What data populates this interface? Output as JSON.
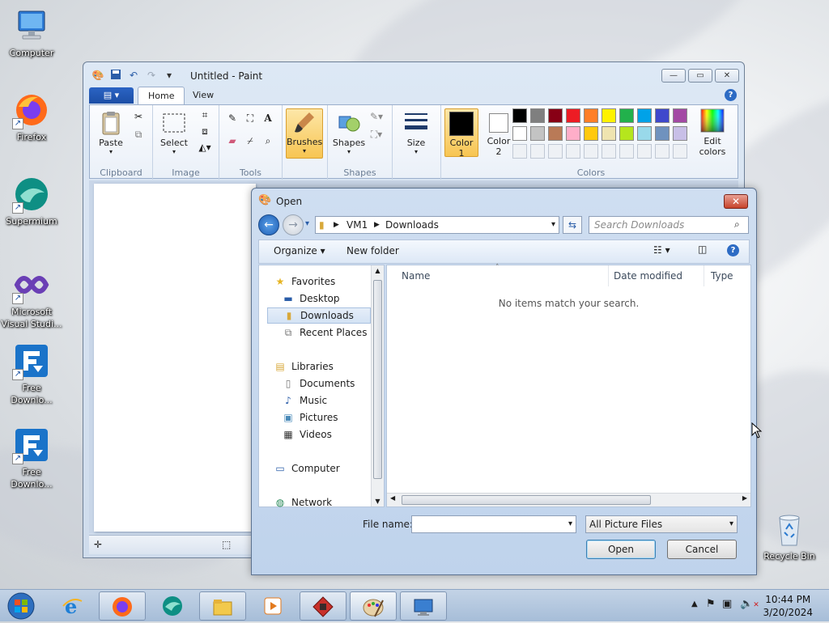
{
  "desktop": {
    "icons": [
      {
        "label": "Computer"
      },
      {
        "label": "Firefox"
      },
      {
        "label": "Supermium"
      },
      {
        "label_line1": "Microsoft",
        "label_line2": "Visual Studi..."
      },
      {
        "label_line1": "Free",
        "label_line2": "Downlo..."
      },
      {
        "label_line1": "Free",
        "label_line2": "Downlo..."
      },
      {
        "label": "Recycle Bin"
      }
    ]
  },
  "paint": {
    "title": "Untitled - Paint",
    "tabs": [
      "Home",
      "View"
    ],
    "groups": {
      "clipboard": {
        "name": "Clipboard",
        "paste": "Paste"
      },
      "image": {
        "name": "Image",
        "select": "Select"
      },
      "tools": {
        "name": "Tools"
      },
      "brushes": {
        "label": "Brushes"
      },
      "shapes": {
        "name": "Shapes",
        "label": "Shapes"
      },
      "size": {
        "label": "Size"
      },
      "colors": {
        "name": "Colors",
        "color1_line1": "Color",
        "color1_line2": "1",
        "color2_line1": "Color",
        "color2_line2": "2",
        "edit_line1": "Edit",
        "edit_line2": "colors",
        "color1_value": "#000000",
        "color2_value": "#ffffff",
        "palette_row1": [
          "#000000",
          "#7f7f7f",
          "#880015",
          "#ed1c24",
          "#ff7f27",
          "#fff200",
          "#22b14c",
          "#00a2e8",
          "#3f48cc",
          "#a349a4"
        ],
        "palette_row2": [
          "#ffffff",
          "#c3c3c3",
          "#b97a57",
          "#ffaec9",
          "#ffc90e",
          "#efe4b0",
          "#b5e61d",
          "#99d9ea",
          "#7092be",
          "#c8bfe7"
        ]
      }
    }
  },
  "dialog": {
    "title": "Open",
    "breadcrumb": [
      "VM1",
      "Downloads"
    ],
    "search_placeholder": "Search Downloads",
    "organize": "Organize",
    "new_folder": "New folder",
    "nav": {
      "favorites": "Favorites",
      "desktop": "Desktop",
      "downloads": "Downloads",
      "recent": "Recent Places",
      "libraries": "Libraries",
      "documents": "Documents",
      "music": "Music",
      "pictures": "Pictures",
      "videos": "Videos",
      "computer": "Computer",
      "network": "Network"
    },
    "columns": {
      "name": "Name",
      "date": "Date modified",
      "type": "Type"
    },
    "empty_message": "No items match your search.",
    "file_name_label": "File name:",
    "file_name_value": "",
    "file_type": "All Picture Files",
    "open_button": "Open",
    "cancel_button": "Cancel"
  },
  "taskbar": {
    "time": "10:44 PM",
    "date": "3/20/2024"
  }
}
